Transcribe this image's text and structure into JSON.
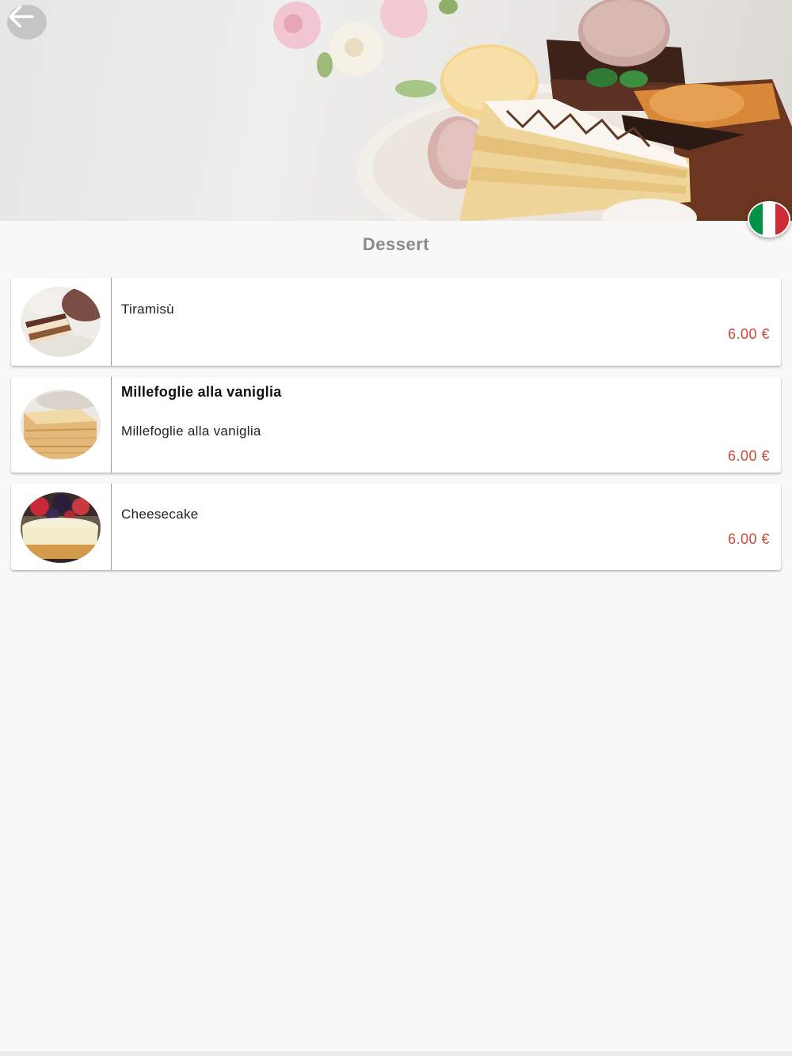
{
  "header": {
    "back_icon": "arrow-left-icon",
    "language_flag": "italy-flag-icon",
    "flag_colors": [
      "#009246",
      "#ffffff",
      "#ce2b37"
    ]
  },
  "page": {
    "title": "Dessert"
  },
  "menu": {
    "items": [
      {
        "name": "Tiramisù",
        "description": "",
        "price": "6.00 €",
        "image": "tiramisu-image"
      },
      {
        "name": "Millefoglie alla vaniglia",
        "description": "Millefoglie alla vaniglia",
        "price": "6.00 €",
        "image": "millefoglie-image"
      },
      {
        "name": "Cheesecake",
        "description": "",
        "price": "6.00 €",
        "image": "cheesecake-image"
      }
    ]
  },
  "colors": {
    "price": "#cc4a3a",
    "title": "#8a8a8a",
    "background": "#f8f8f8"
  }
}
